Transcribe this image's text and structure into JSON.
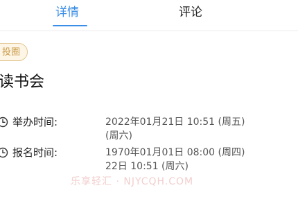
{
  "tabs": {
    "details_label": "详情",
    "comments_label": "评论",
    "active_color": "#3a8ee6"
  },
  "tag": {
    "label": "投圈"
  },
  "event": {
    "title": "读书会"
  },
  "info": {
    "hold_time_label": "举办时间:",
    "hold_time_value": "2022年01月21日 10:51 (周五)\n(周六)",
    "signup_time_label": "报名时间:",
    "signup_time_value": "1970年01月01日 08:00 (周四)\n22日 10:51 (周六)",
    "icon": "clock-icon"
  },
  "watermark": {
    "text": "乐享轻汇 · NJYCQH.COM"
  }
}
